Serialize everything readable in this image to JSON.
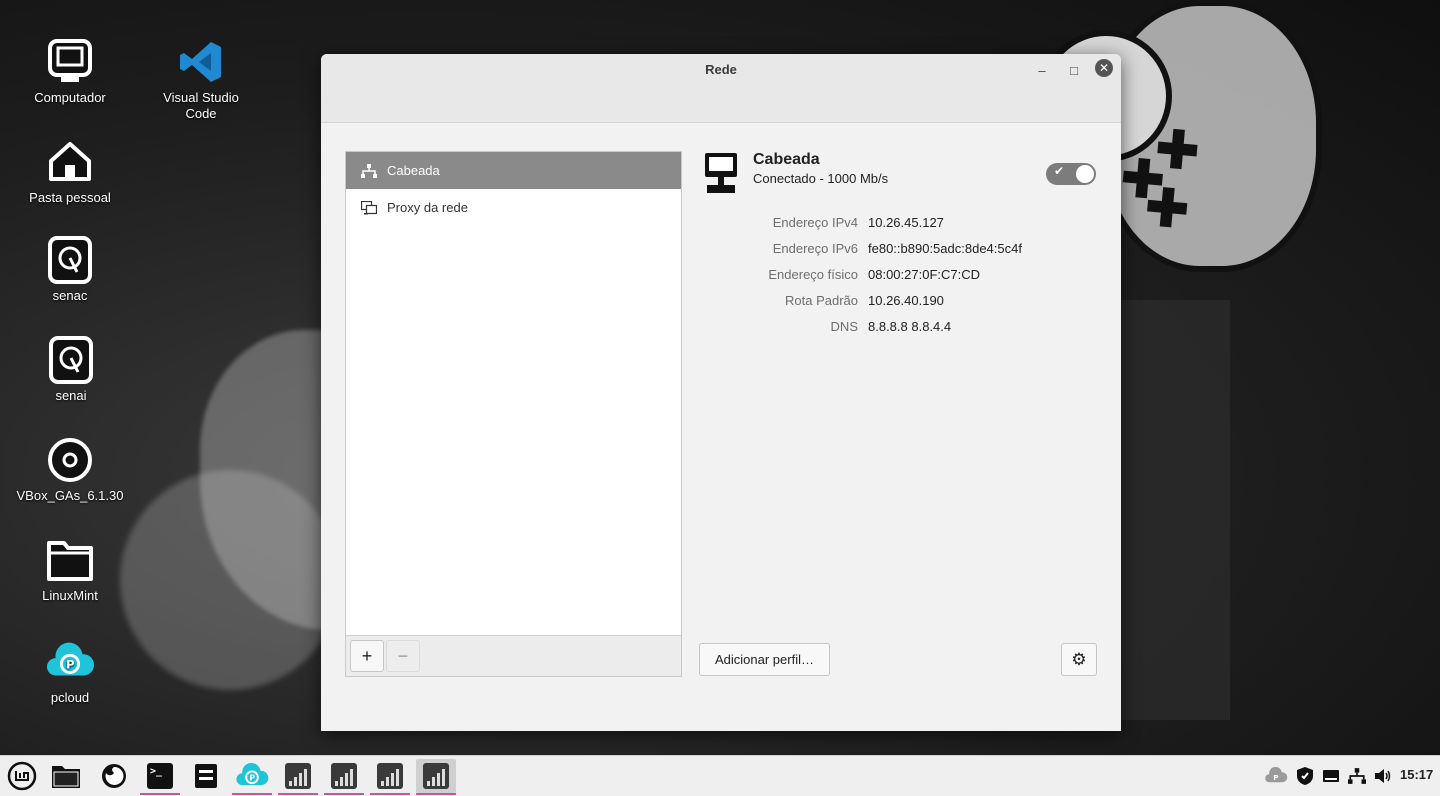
{
  "desktop": {
    "icons": [
      {
        "label": "Computador",
        "icon": "computer-icon"
      },
      {
        "label": "Visual Studio Code",
        "icon": "vscode-icon"
      },
      {
        "label": "Pasta pessoal",
        "icon": "home-folder-icon"
      },
      {
        "label": "senac",
        "icon": "drive-icon"
      },
      {
        "label": "senai",
        "icon": "drive-icon"
      },
      {
        "label": "VBox_GAs_6.1.30",
        "icon": "disc-icon"
      },
      {
        "label": "LinuxMint",
        "icon": "folder-icon"
      },
      {
        "label": "pcloud",
        "icon": "pcloud-icon"
      }
    ]
  },
  "window": {
    "title": "Rede",
    "controls": {
      "minimize": "–",
      "maximize": "□",
      "close": "✕"
    }
  },
  "sidebar": {
    "items": [
      {
        "label": "Cabeada",
        "icon": "wired-network-icon",
        "selected": true
      },
      {
        "label": "Proxy da rede",
        "icon": "proxy-icon",
        "selected": false
      }
    ],
    "add_label": "+",
    "remove_label": "−"
  },
  "connection": {
    "name": "Cabeada",
    "status": "Conectado - 1000 Mb/s",
    "enabled": true,
    "properties": [
      {
        "label": "Endereço IPv4",
        "value": "10.26.45.127"
      },
      {
        "label": "Endereço IPv6",
        "value": "fe80::b890:5adc:8de4:5c4f"
      },
      {
        "label": "Endereço físico",
        "value": "08:00:27:0F:C7:CD"
      },
      {
        "label": "Rota Padrão",
        "value": "10.26.40.190"
      },
      {
        "label": "DNS",
        "value": "8.8.8.8 8.8.4.4"
      }
    ],
    "add_profile_label": "Adicionar perfil…"
  },
  "taskbar": {
    "clock": "15:17",
    "apps": [
      "menu-icon",
      "files-icon",
      "firefox-icon",
      "terminal-icon",
      "archive-icon",
      "pcloud-icon",
      "system-monitor-icon",
      "system-monitor-icon",
      "system-monitor-icon",
      "system-monitor-icon"
    ]
  },
  "colors": {
    "selected": "#8a8a8a",
    "window_bg": "#f2f2f2",
    "accent_underline": "#c6579a"
  }
}
